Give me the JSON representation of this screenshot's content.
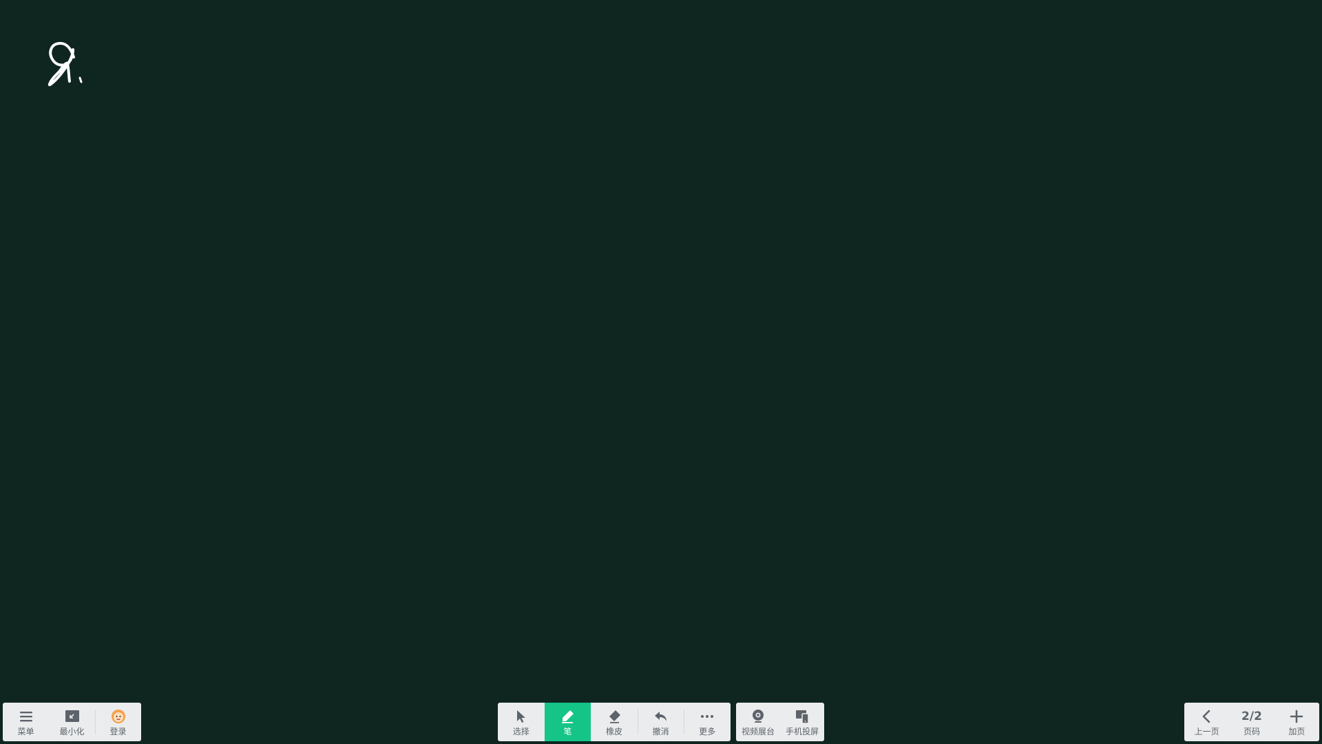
{
  "canvas": {
    "background_color": "#0f2620",
    "ink_color": "#ffffff"
  },
  "left_toolbar": {
    "menu_label": "菜单",
    "minimize_label": "最小化",
    "login_label": "登录"
  },
  "tool_toolbar": {
    "select_label": "选择",
    "pen_label": "笔",
    "eraser_label": "橡皮",
    "undo_label": "撤消",
    "more_label": "更多",
    "active_tool": "pen",
    "active_color": "#15c487"
  },
  "share_toolbar": {
    "video_booth_label": "视频展台",
    "phone_cast_label": "手机投屏"
  },
  "page_toolbar": {
    "prev_label": "上一页",
    "page_indicator": "2/2",
    "page_label": "页码",
    "add_page_label": "加页"
  }
}
